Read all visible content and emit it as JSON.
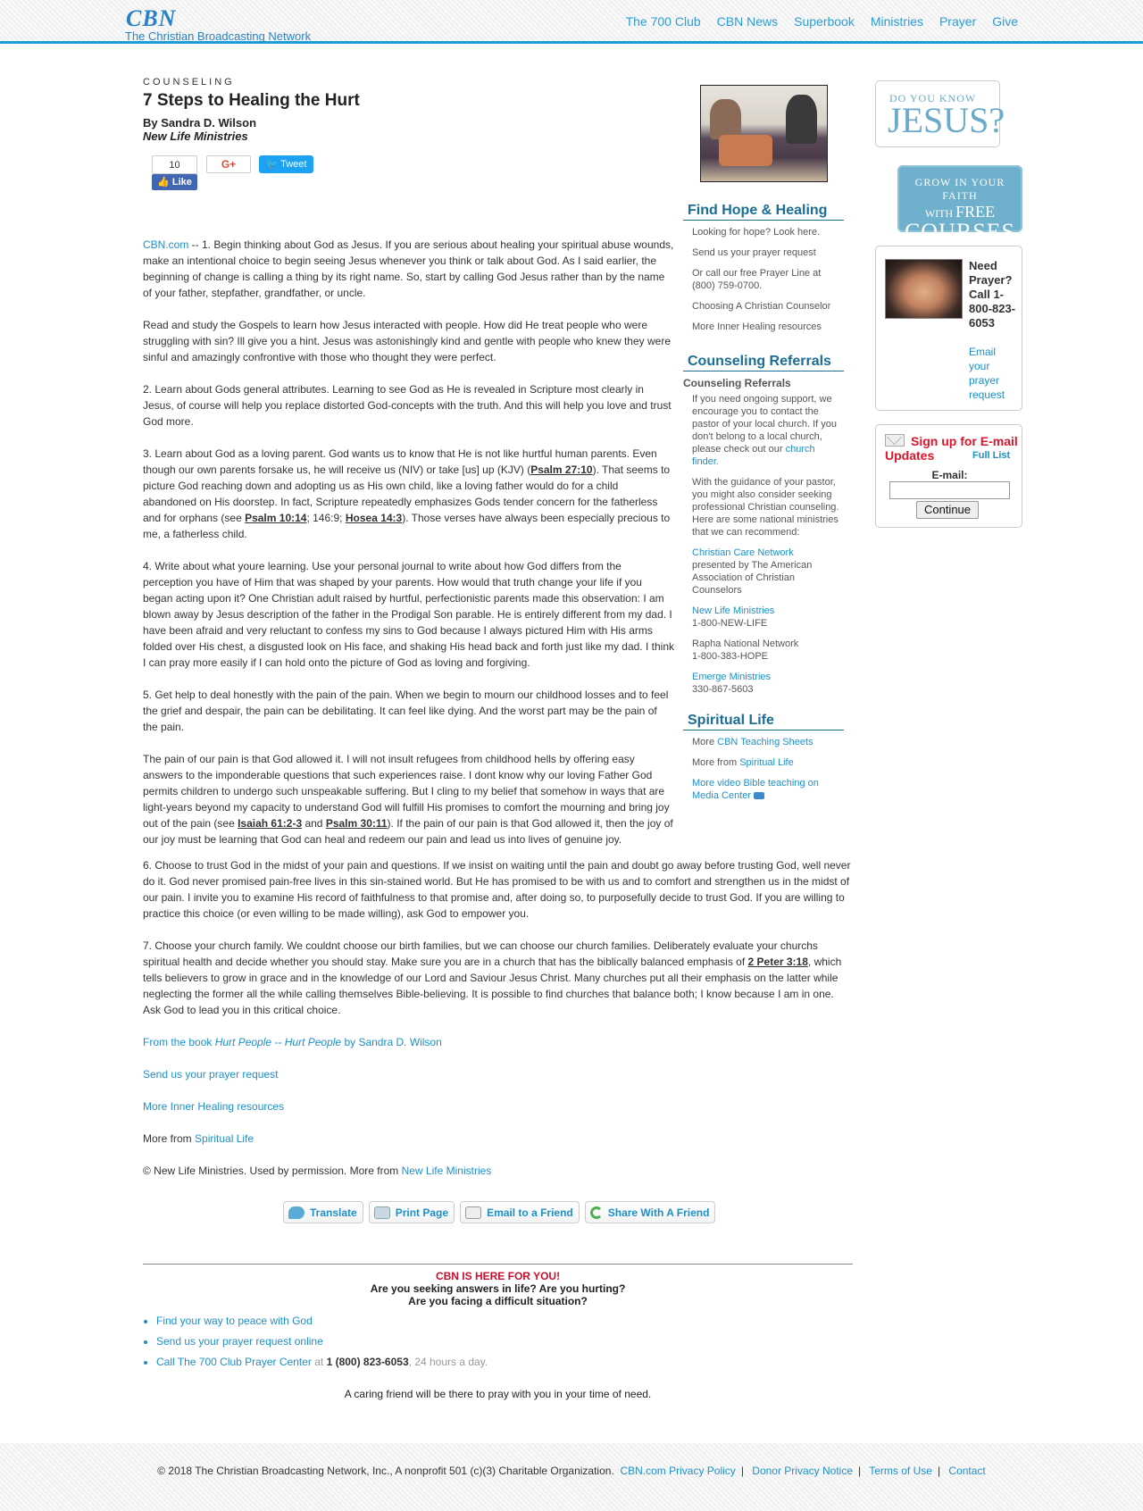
{
  "header": {
    "logo": "CBN",
    "tagline": "The Christian Broadcasting Network",
    "nav": [
      "The 700 Club",
      "CBN News",
      "Superbook",
      "Ministries",
      "Prayer",
      "Give"
    ]
  },
  "article": {
    "section": "COUNSELING",
    "title": "7 Steps to Healing the Hurt",
    "author": "By Sandra D. Wilson",
    "org": "New Life Ministries",
    "social": {
      "fb_count": "10",
      "fb_like": "Like",
      "gplus": "G+",
      "tweet": "Tweet"
    },
    "p1_link": "CBN.com",
    "p1": " -- 1. Begin thinking about God as Jesus. If you are serious about healing your spiritual abuse wounds, make an intentional choice to begin seeing Jesus whenever you think or talk about God. As I said earlier, the beginning of change is calling a thing by its right name. So, start by calling God Jesus rather than by the name of your father, stepfather, grandfather, or uncle.",
    "p2": "Read and study the Gospels to learn how Jesus interacted with people. How did He treat people who were struggling with sin? Ill give you a hint. Jesus was astonishingly kind and gentle with people who knew they were sinful and amazingly confrontive with those who thought they were perfect.",
    "p3": "2. Learn about Gods general attributes. Learning to see God as He is revealed in Scripture most clearly in Jesus, of course will help you replace distorted God-concepts with the truth. And this will help you love and trust God more.",
    "p4": {
      "a": "3. Learn about God as a loving parent. God wants us to know that He is not like hurtful human parents. Even though our own parents forsake us, he will receive us (NIV) or take [us] up (KJV) (",
      "ref1": "Psalm 27:10",
      "b": "). That seems to picture God reaching down and adopting us as His own child, like a loving father would do for a child abandoned on His doorstep. In fact, Scripture repeatedly emphasizes Gods tender concern for the fatherless and for orphans (see ",
      "ref2": "Psalm 10:14",
      "c": "; 146:9; ",
      "ref3": "Hosea 14:3",
      "d": "). Those verses have always been especially precious to me, a fatherless child."
    },
    "p5": "4. Write about what youre learning. Use your personal journal to write about how God differs from the perception you have of Him that was shaped by your parents. How would that truth change your life if you began acting upon it? One Christian adult raised by hurtful, perfectionistic parents made this observation: I am blown away by Jesus description of the father in the Prodigal Son parable. He is entirely different from my dad. I have been afraid and very reluctant to confess my sins to God because I always pictured Him with His arms folded over His chest, a disgusted look on His face, and shaking His head back and forth just like my dad. I think I can pray more easily if I can hold onto the picture of God as loving and forgiving.",
    "p6": "5. Get help to deal honestly with the pain of the pain. When we begin to mourn our childhood losses and to feel the grief and despair, the pain can be debilitating. It can feel like dying. And the worst part may be the pain of the pain.",
    "p7": {
      "a": "The pain of our pain is that God allowed it. I will not insult refugees from childhood hells by offering easy answers to the imponderable questions that such experiences raise. I dont know why our loving Father God permits children to undergo such unspeakable suffering. But I cling to my belief that somehow in ways that are light-years beyond my capacity to understand God will fulfill His promises to comfort the mourning and bring joy out of the pain (see ",
      "ref1": "Isaiah 61:2-3",
      "b": " and ",
      "ref2": "Psalm 30:11",
      "c": "). If the pain of our pain is that God allowed it, then the joy of our joy must be learning that God can heal and redeem our pain and lead us into lives of genuine joy."
    },
    "p8": "6. Choose to trust God in the midst of your pain and questions. If we insist on waiting until the pain and doubt go away before trusting God, well never do it. God never promised pain-free lives in this sin-stained world. But He has promised to be with us and to comfort and strengthen us in the midst of our pain. I invite you to examine His record of faithfulness to that promise and, after doing so, to purposefully decide to trust God. If you are willing to practice this choice (or even willing to be made willing), ask God to empower you.",
    "p9": {
      "a": "7. Choose your church family. We couldnt choose our birth families, but we can choose our church families. Deliberately evaluate your churchs spiritual health and decide whether you should stay. Make sure you are in a church that has the biblically balanced emphasis of ",
      "ref1": "2 Peter 3:18",
      "b": ", which tells believers to grow in grace and in the knowledge of our Lord and Saviour Jesus Christ. Many churches put all their emphasis on the latter while neglecting the former all the while calling themselves Bible-believing. It is possible to find churches that balance both; I know because I am in one. Ask God to lead you in this critical choice."
    },
    "book_a": "From the book ",
    "book_title": "Hurt People -- Hurt People",
    "book_b": " by Sandra D. Wilson",
    "prayer_link": "Send us your prayer request",
    "inner_link": "More Inner Healing resources",
    "more_from": "More from ",
    "more_from_link": "Spiritual Life",
    "copyright": "© New Life Ministries. Used by permission. More from ",
    "copyright_link": "New Life Ministries"
  },
  "sidebar": {
    "hope": {
      "heading": "Find Hope & Healing",
      "items": [
        "Looking for hope? Look here.",
        "Send us your prayer request",
        "Or call our free Prayer Line at (800) 759-0700.",
        "Choosing A Christian Counselor",
        "More Inner Healing resources"
      ]
    },
    "referrals": {
      "heading": "Counseling Referrals",
      "sub": "Counseling Referrals",
      "intro": "If you need ongoing support, we encourage you to contact the pastor of your local church. If you don't belong to a local church, please check out our ",
      "intro_link": "church finder",
      "guidance": "With the guidance of your pastor, you might also consider seeking professional Christian counseling. Here are some national ministries that we can recommend:",
      "ccn_link": "Christian Care Network",
      "ccn_text": "presented by The American Association of Christian Counselors",
      "nlm_link": "New Life Ministries",
      "nlm_phone": "1-800-NEW-LIFE",
      "rapha": "Rapha National Network",
      "rapha_phone": "1-800-383-HOPE",
      "emerge_link": "Emerge Ministries",
      "emerge_phone": "330-867-5603"
    },
    "spiritual": {
      "heading": "Spiritual Life",
      "more1": "More ",
      "more1_link": "CBN Teaching Sheets",
      "more2": "More from ",
      "more2_link": "Spiritual Life",
      "video_link": "More video Bible teaching on Media Center"
    }
  },
  "right": {
    "djesus_1": "DO YOU KNOW",
    "djesus_2": "JESUS?",
    "fc_1": "GROW IN YOUR FAITH",
    "fc_2a": "WITH ",
    "fc_2b": "FREE",
    "fc_3": "COURSES",
    "prayer_text": "Need Prayer? Call 1-800-823-6053",
    "prayer_link": "Email your prayer request",
    "signup_heading": "Sign up for E-mail Updates",
    "signup_full": "Full List",
    "signup_label": "E-mail:",
    "signup_button": "Continue"
  },
  "actions": [
    "Translate",
    "Print Page",
    "Email to a Friend",
    "Share With A Friend"
  ],
  "help": {
    "h1": "CBN IS HERE FOR YOU!",
    "h2a": "Are you seeking answers in life? Are you hurting?",
    "h2b": "Are you facing a difficult situation?",
    "item1": "Find your way to peace with God",
    "item2": "Send us your prayer request online",
    "item3_link": "Call The 700 Club Prayer Center",
    "item3_at": " at ",
    "item3_phone": "1 (800) 823-6053",
    "item3_tail": ", 24 hours a day.",
    "caring": "A caring friend will be there to pray with you in your time of need."
  },
  "footer": {
    "copyright": "© 2018 The Christian Broadcasting Network, Inc., A nonprofit 501 (c)(3) Charitable Organization.",
    "links": [
      "CBN.com Privacy Policy",
      "Donor Privacy Notice",
      "Terms of Use",
      "Contact"
    ]
  },
  "colors": {
    "accent": "#1e90c8",
    "brand": "#2a82c4",
    "heading": "#1b6d95",
    "alert": "#e0142b"
  }
}
